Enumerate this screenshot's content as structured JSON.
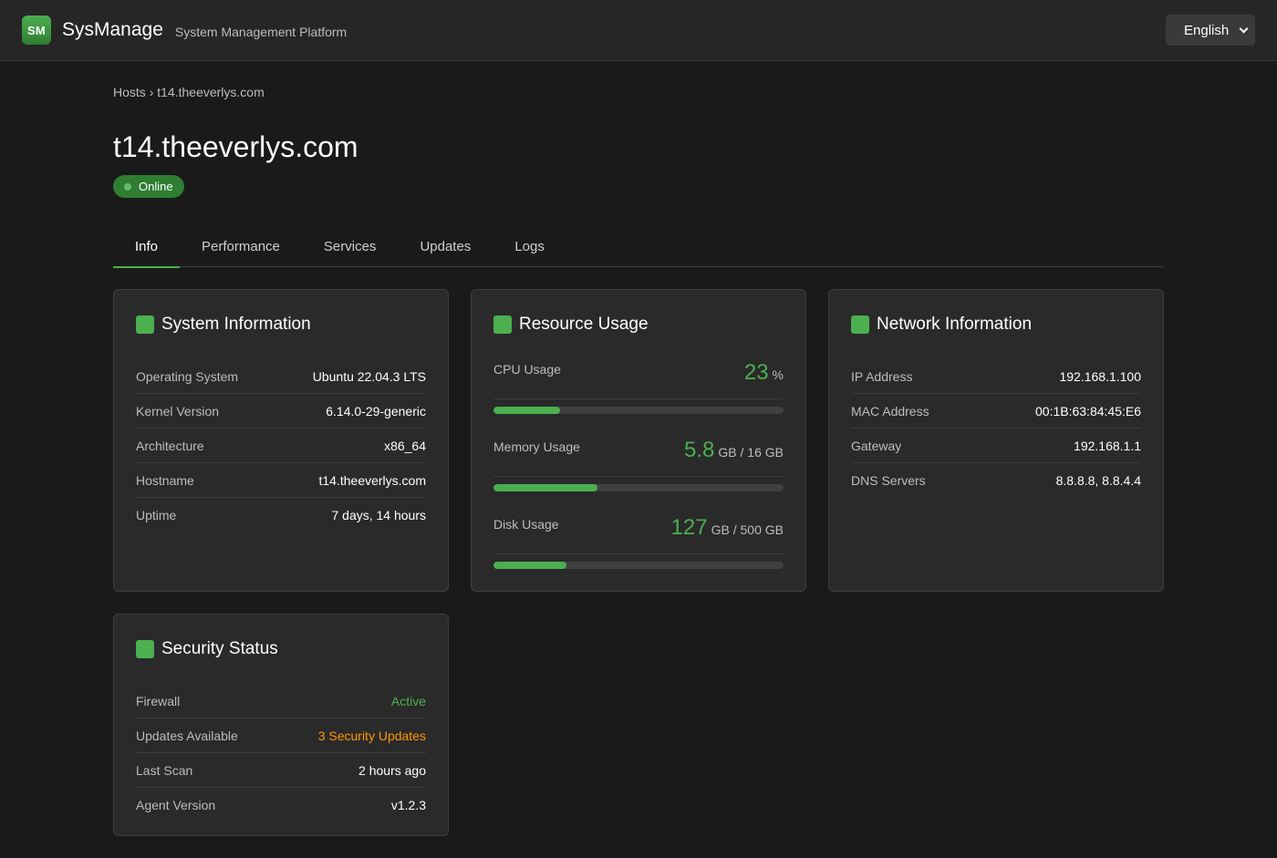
{
  "app": {
    "logo": "SM",
    "name": "SysManage",
    "subtitle": "System Management Platform"
  },
  "language": {
    "selected": "English"
  },
  "breadcrumb": {
    "parent": "Hosts",
    "separator": "›",
    "current": "t14.theeverlys.com"
  },
  "host": {
    "title": "t14.theeverlys.com",
    "status": "Online"
  },
  "tabs": [
    {
      "label": "Info",
      "active": true
    },
    {
      "label": "Performance",
      "active": false
    },
    {
      "label": "Services",
      "active": false
    },
    {
      "label": "Updates",
      "active": false
    },
    {
      "label": "Logs",
      "active": false
    }
  ],
  "system": {
    "title": "System Information",
    "rows": [
      {
        "label": "Operating System",
        "value": "Ubuntu 22.04.3 LTS"
      },
      {
        "label": "Kernel Version",
        "value": "6.14.0-29-generic"
      },
      {
        "label": "Architecture",
        "value": "x86_64"
      },
      {
        "label": "Hostname",
        "value": "t14.theeverlys.com"
      },
      {
        "label": "Uptime",
        "value": "7 days, 14 hours"
      }
    ]
  },
  "resources": {
    "title": "Resource Usage",
    "items": [
      {
        "label": "CPU Usage",
        "value": "23",
        "unit": "%",
        "percent": 23
      },
      {
        "label": "Memory Usage",
        "value": "5.8",
        "unit": "GB / 16 GB",
        "percent": 36
      },
      {
        "label": "Disk Usage",
        "value": "127",
        "unit": "GB / 500 GB",
        "percent": 25
      }
    ]
  },
  "network": {
    "title": "Network Information",
    "rows": [
      {
        "label": "IP Address",
        "value": "192.168.1.100"
      },
      {
        "label": "MAC Address",
        "value": "00:1B:63:84:45:E6"
      },
      {
        "label": "Gateway",
        "value": "192.168.1.1"
      },
      {
        "label": "DNS Servers",
        "value": "8.8.8.8, 8.8.4.4"
      }
    ]
  },
  "security": {
    "title": "Security Status",
    "rows": [
      {
        "label": "Firewall",
        "value": "Active",
        "color": "#4caf50"
      },
      {
        "label": "Updates Available",
        "value": "3 Security Updates",
        "color": "#ff9800"
      },
      {
        "label": "Last Scan",
        "value": "2 hours ago"
      },
      {
        "label": "Agent Version",
        "value": "v1.2.3"
      }
    ]
  },
  "colors": {
    "accent": "#4caf50",
    "warning": "#ff9800",
    "background": "#1a1a1a",
    "card": "#2a2a2a"
  }
}
